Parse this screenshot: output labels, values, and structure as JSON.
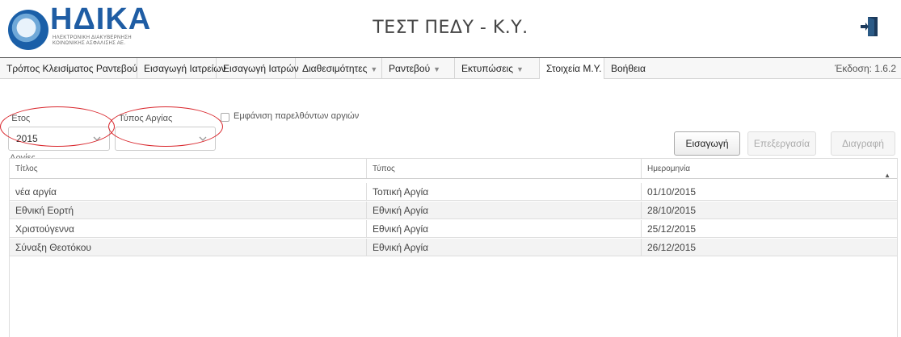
{
  "header": {
    "logo_text": "ΗΔΙΚΑ",
    "logo_subtitle_1": "ΗΛΕΚΤΡΟΝΙΚΗ ΔΙΑΚΥΒΕΡΝΗΣΗ",
    "logo_subtitle_2": "ΚΟΙΝΩΝΙΚΗΣ ΑΣΦΑΛΙΣΗΣ ΑΕ.",
    "title": "ΤΕΣΤ ΠΕΔΥ - Κ.Υ.",
    "exit_icon": "exit-door-icon"
  },
  "nav": {
    "items": [
      {
        "label": "Τρόπος Κλεισίματος Ραντεβού",
        "dropdown": false
      },
      {
        "label": "Εισαγωγή Ιατρείων",
        "dropdown": false
      },
      {
        "label": "Εισαγωγή Ιατρών",
        "dropdown": false
      },
      {
        "label": "Διαθεσιμότητες",
        "dropdown": true
      },
      {
        "label": "Ραντεβού",
        "dropdown": true
      },
      {
        "label": "Εκτυπώσεις",
        "dropdown": true
      },
      {
        "label": "Στοιχεία Μ.Υ.",
        "dropdown": false
      },
      {
        "label": "Βοήθεια",
        "dropdown": false
      }
    ],
    "version": "Έκδοση: 1.6.2"
  },
  "filters": {
    "year_label": "Έτος",
    "year_value": "2015",
    "type_label": "Τύπος Αργίας",
    "type_value": "",
    "show_past_label": "Εμφάνιση παρελθόντων αργιών",
    "show_past_checked": false
  },
  "actions": {
    "insert": "Εισαγωγή",
    "edit": "Επεξεργασία",
    "delete": "Διαγραφή"
  },
  "table": {
    "section_title": "Αργίες",
    "columns": [
      "Τίτλος",
      "Τύπος",
      "Ημερομηνία"
    ],
    "rows": [
      [
        "νέα αργία",
        "Τοπική Αργία",
        "01/10/2015"
      ],
      [
        "Εθνική Εορτή",
        "Εθνική Αργία",
        "28/10/2015"
      ],
      [
        "Χριστούγεννα",
        "Εθνική Αργία",
        "25/12/2015"
      ],
      [
        "Σύναξη Θεοτόκου",
        "Εθνική Αργία",
        "26/12/2015"
      ]
    ]
  },
  "colors": {
    "brand_blue": "#1f5da4",
    "annotation_red": "#d9262c"
  }
}
